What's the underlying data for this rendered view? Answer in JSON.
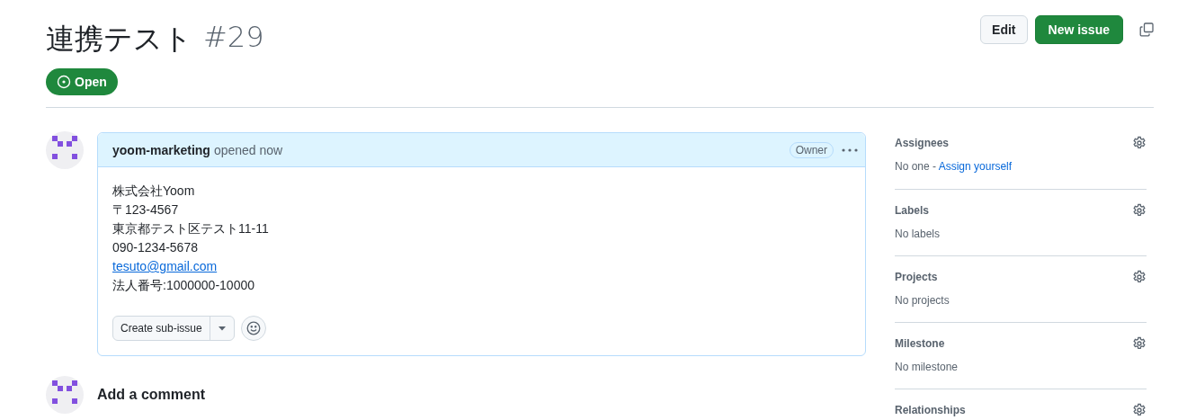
{
  "issue": {
    "title": "連携テスト",
    "number": "#29",
    "state": "Open"
  },
  "header_buttons": [
    {
      "label": "Edit",
      "kind": "default"
    },
    {
      "label": "New issue",
      "kind": "primary"
    }
  ],
  "comment": {
    "author": "yoom-marketing",
    "action": "opened now",
    "badge": "Owner",
    "body": [
      {
        "kind": "text",
        "text": "株式会社Yoom"
      },
      {
        "kind": "text",
        "text": "〒123-4567"
      },
      {
        "kind": "text",
        "text": "東京都テスト区テスト11-11"
      },
      {
        "kind": "text",
        "text": "090-1234-5678"
      },
      {
        "kind": "link",
        "text": "tesuto@gmail.com"
      },
      {
        "kind": "text",
        "text": "法人番号:1000000-10000"
      }
    ],
    "sub_issue_button": "Create sub-issue"
  },
  "add_comment": {
    "title": "Add a comment"
  },
  "sidebar": [
    {
      "title": "Assignees",
      "value": "No one - ",
      "action": "Assign yourself"
    },
    {
      "title": "Labels",
      "value": "No labels"
    },
    {
      "title": "Projects",
      "value": "No projects"
    },
    {
      "title": "Milestone",
      "value": "No milestone"
    },
    {
      "title": "Relationships"
    }
  ]
}
